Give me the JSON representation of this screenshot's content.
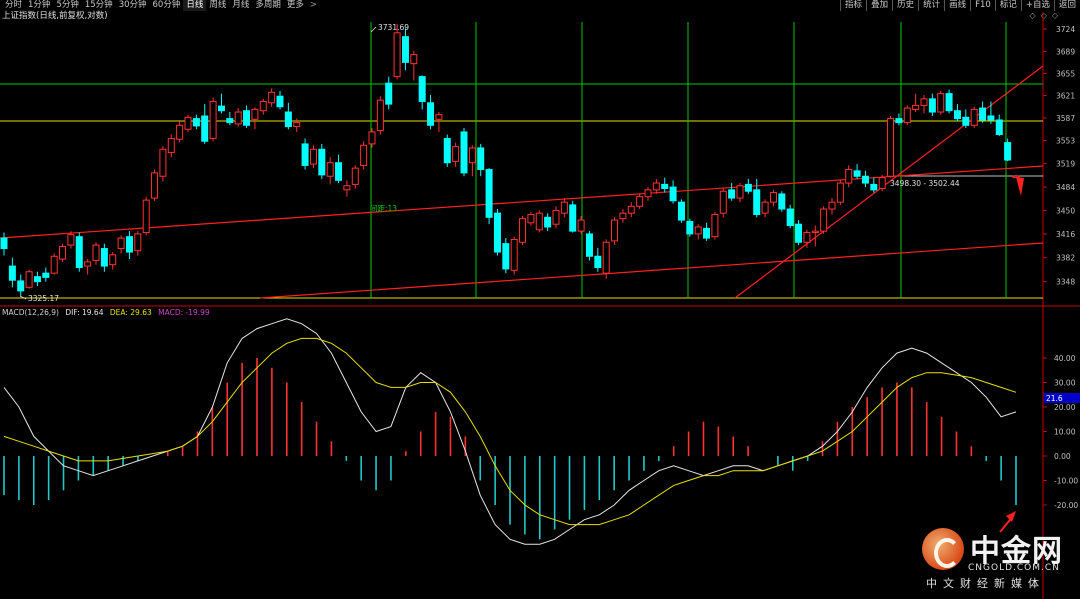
{
  "toolbar": {
    "tabs": [
      "分时",
      "1分钟",
      "5分钟",
      "15分钟",
      "30分钟",
      "60分钟",
      "日线",
      "周线",
      "月线",
      "多周期",
      "更多"
    ],
    "active_tab": "日线",
    "more_arrow": ">",
    "tools": [
      "指标",
      "叠加",
      "历史",
      "统计",
      "画线",
      "F10",
      "标记",
      "+自选",
      "返回"
    ]
  },
  "title": {
    "name": "上证指数(日线,前复权,对数)"
  },
  "window_controls": [
    "◇",
    "◇",
    "◇"
  ],
  "colors": {
    "up": "#ff3232",
    "down": "#00ffff",
    "ma_yellow": "#e8e000",
    "green": "#00c800",
    "axis": "#c80000",
    "text_red": "#ff5050"
  },
  "price_axis": {
    "labels": [
      "3724",
      "3689",
      "3655",
      "3621",
      "3587",
      "3553",
      "3519",
      "3484",
      "3450",
      "3416",
      "3382",
      "3348"
    ],
    "min": 3325,
    "max": 3735
  },
  "annotations": {
    "high_label": "3731.69",
    "low_label": "3325.17",
    "interval_label": "间距:13",
    "range_label": "3498.30 - 3502.44"
  },
  "macd": {
    "name": "MACD(12,26,9)",
    "dif_label": "DIF: 19.64",
    "dea_label": "DEA: 29.63",
    "macd_label": "MACD: -19.99",
    "axis_labels": [
      "40.00",
      "30.00",
      "20.00",
      "10.00",
      "0.00",
      "-10.00",
      "-20.00"
    ],
    "current_badge": "21.6"
  },
  "chart_data": {
    "type": "candlestick",
    "title": "上证指数(日线,前复权,对数)",
    "ylim": [
      3325,
      3735
    ],
    "candles": [
      [
        3410,
        3418,
        3385,
        3395
      ],
      [
        3370,
        3382,
        3340,
        3350
      ],
      [
        3349,
        3358,
        3328,
        3335
      ],
      [
        3340,
        3365,
        3338,
        3362
      ],
      [
        3355,
        3362,
        3342,
        3348
      ],
      [
        3360,
        3368,
        3348,
        3354
      ],
      [
        3360,
        3388,
        3358,
        3384
      ],
      [
        3380,
        3402,
        3376,
        3398
      ],
      [
        3400,
        3420,
        3395,
        3415
      ],
      [
        3412,
        3418,
        3362,
        3368
      ],
      [
        3370,
        3380,
        3358,
        3376
      ],
      [
        3378,
        3404,
        3372,
        3400
      ],
      [
        3395,
        3402,
        3362,
        3370
      ],
      [
        3372,
        3390,
        3365,
        3386
      ],
      [
        3395,
        3414,
        3388,
        3410
      ],
      [
        3412,
        3420,
        3380,
        3390
      ],
      [
        3392,
        3420,
        3385,
        3416
      ],
      [
        3418,
        3470,
        3414,
        3465
      ],
      [
        3468,
        3510,
        3464,
        3505
      ],
      [
        3500,
        3545,
        3492,
        3540
      ],
      [
        3535,
        3562,
        3528,
        3556
      ],
      [
        3555,
        3582,
        3550,
        3576
      ],
      [
        3570,
        3592,
        3566,
        3588
      ],
      [
        3586,
        3592,
        3570,
        3575
      ],
      [
        3590,
        3608,
        3548,
        3552
      ],
      [
        3556,
        3618,
        3552,
        3612
      ],
      [
        3605,
        3624,
        3594,
        3598
      ],
      [
        3586,
        3596,
        3576,
        3580
      ],
      [
        3578,
        3602,
        3574,
        3596
      ],
      [
        3598,
        3606,
        3572,
        3576
      ],
      [
        3585,
        3603,
        3570,
        3600
      ],
      [
        3598,
        3616,
        3592,
        3612
      ],
      [
        3610,
        3632,
        3604,
        3626
      ],
      [
        3620,
        3628,
        3600,
        3604
      ],
      [
        3596,
        3610,
        3570,
        3574
      ],
      [
        3574,
        3586,
        3566,
        3580
      ],
      [
        3548,
        3556,
        3510,
        3516
      ],
      [
        3518,
        3546,
        3512,
        3540
      ],
      [
        3540,
        3548,
        3496,
        3502
      ],
      [
        3500,
        3528,
        3488,
        3520
      ],
      [
        3520,
        3532,
        3490,
        3494
      ],
      [
        3480,
        3494,
        3470,
        3486
      ],
      [
        3488,
        3516,
        3482,
        3512
      ],
      [
        3516,
        3552,
        3510,
        3546
      ],
      [
        3548,
        3572,
        3542,
        3566
      ],
      [
        3568,
        3620,
        3562,
        3614
      ],
      [
        3640,
        3650,
        3600,
        3608
      ],
      [
        3650,
        3732,
        3646,
        3718
      ],
      [
        3712,
        3725,
        3660,
        3672
      ],
      [
        3670,
        3690,
        3644,
        3684
      ],
      [
        3650,
        3652,
        3600,
        3612
      ],
      [
        3610,
        3622,
        3570,
        3576
      ],
      [
        3585,
        3596,
        3566,
        3592
      ],
      [
        3556,
        3562,
        3514,
        3520
      ],
      [
        3522,
        3550,
        3514,
        3544
      ],
      [
        3566,
        3572,
        3500,
        3505
      ],
      [
        3520,
        3546,
        3500,
        3542
      ],
      [
        3542,
        3548,
        3500,
        3510
      ],
      [
        3510,
        3512,
        3430,
        3440
      ],
      [
        3446,
        3452,
        3385,
        3390
      ],
      [
        3402,
        3410,
        3360,
        3366
      ],
      [
        3364,
        3412,
        3358,
        3408
      ],
      [
        3404,
        3442,
        3400,
        3438
      ],
      [
        3432,
        3448,
        3428,
        3444
      ],
      [
        3422,
        3450,
        3418,
        3446
      ],
      [
        3440,
        3446,
        3420,
        3426
      ],
      [
        3430,
        3456,
        3424,
        3450
      ],
      [
        3446,
        3468,
        3440,
        3462
      ],
      [
        3458,
        3464,
        3418,
        3420
      ],
      [
        3420,
        3442,
        3416,
        3436
      ],
      [
        3416,
        3420,
        3378,
        3384
      ],
      [
        3384,
        3396,
        3362,
        3368
      ],
      [
        3360,
        3408,
        3352,
        3404
      ],
      [
        3406,
        3440,
        3400,
        3436
      ],
      [
        3438,
        3452,
        3432,
        3446
      ],
      [
        3446,
        3462,
        3440,
        3456
      ],
      [
        3456,
        3474,
        3452,
        3470
      ],
      [
        3470,
        3484,
        3464,
        3480
      ],
      [
        3480,
        3496,
        3474,
        3490
      ],
      [
        3488,
        3498,
        3476,
        3482
      ],
      [
        3484,
        3494,
        3460,
        3464
      ],
      [
        3462,
        3466,
        3432,
        3436
      ],
      [
        3434,
        3438,
        3412,
        3416
      ],
      [
        3416,
        3430,
        3408,
        3426
      ],
      [
        3424,
        3432,
        3406,
        3410
      ],
      [
        3412,
        3448,
        3408,
        3444
      ],
      [
        3446,
        3482,
        3440,
        3478
      ],
      [
        3480,
        3490,
        3464,
        3468
      ],
      [
        3468,
        3490,
        3462,
        3486
      ],
      [
        3488,
        3496,
        3474,
        3478
      ],
      [
        3480,
        3496,
        3440,
        3444
      ],
      [
        3446,
        3466,
        3440,
        3462
      ],
      [
        3462,
        3480,
        3456,
        3476
      ],
      [
        3474,
        3478,
        3448,
        3452
      ],
      [
        3452,
        3458,
        3424,
        3428
      ],
      [
        3430,
        3436,
        3400,
        3404
      ],
      [
        3404,
        3422,
        3396,
        3418
      ],
      [
        3418,
        3428,
        3398,
        3420
      ],
      [
        3420,
        3456,
        3416,
        3452
      ],
      [
        3452,
        3468,
        3444,
        3462
      ],
      [
        3462,
        3494,
        3458,
        3490
      ],
      [
        3490,
        3516,
        3484,
        3510
      ],
      [
        3508,
        3518,
        3496,
        3500
      ],
      [
        3500,
        3508,
        3484,
        3490
      ],
      [
        3488,
        3498,
        3476,
        3480
      ],
      [
        3482,
        3502,
        3478,
        3498
      ],
      [
        3500,
        3590,
        3498,
        3586
      ],
      [
        3586,
        3594,
        3576,
        3580
      ],
      [
        3580,
        3606,
        3576,
        3602
      ],
      [
        3600,
        3624,
        3596,
        3606
      ],
      [
        3606,
        3622,
        3594,
        3616
      ],
      [
        3616,
        3624,
        3590,
        3596
      ],
      [
        3596,
        3628,
        3592,
        3624
      ],
      [
        3624,
        3630,
        3594,
        3598
      ],
      [
        3598,
        3608,
        3582,
        3586
      ],
      [
        3588,
        3600,
        3572,
        3576
      ],
      [
        3576,
        3604,
        3572,
        3600
      ],
      [
        3602,
        3612,
        3580,
        3584
      ],
      [
        3590,
        3612,
        3578,
        3584
      ],
      [
        3584,
        3592,
        3560,
        3562
      ],
      [
        3550,
        3556,
        3522,
        3524
      ],
      [
        3498,
        3502,
        3498,
        3500
      ]
    ],
    "macd_dif": [
      28,
      20,
      8,
      2,
      -4,
      -6,
      -8,
      -6,
      -4,
      -2,
      0,
      2,
      4,
      8,
      20,
      38,
      48,
      52,
      54,
      56,
      54,
      50,
      42,
      30,
      18,
      10,
      12,
      28,
      34,
      30,
      18,
      2,
      -16,
      -28,
      -34,
      -36,
      -36,
      -34,
      -30,
      -26,
      -24,
      -20,
      -14,
      -10,
      -6,
      -4,
      -6,
      -8,
      -6,
      -4,
      -4,
      -6,
      -4,
      -2,
      0,
      4,
      10,
      18,
      28,
      36,
      42,
      44,
      42,
      38,
      34,
      30,
      24,
      16,
      18
    ],
    "macd_dea": [
      8,
      6,
      4,
      2,
      0,
      -2,
      -2,
      -2,
      -1,
      0,
      1,
      2,
      4,
      8,
      14,
      22,
      30,
      36,
      42,
      46,
      48,
      48,
      46,
      42,
      36,
      30,
      28,
      28,
      30,
      30,
      26,
      18,
      8,
      -4,
      -14,
      -20,
      -24,
      -26,
      -28,
      -28,
      -28,
      -26,
      -24,
      -20,
      -16,
      -12,
      -10,
      -8,
      -8,
      -6,
      -6,
      -6,
      -4,
      -2,
      0,
      2,
      6,
      10,
      16,
      22,
      28,
      32,
      34,
      34,
      33,
      32,
      30,
      28,
      26
    ],
    "macd_hist": [
      -16,
      -18,
      -20,
      -18,
      -14,
      -10,
      -8,
      -6,
      -4,
      -2,
      0,
      2,
      4,
      10,
      20,
      30,
      38,
      40,
      36,
      30,
      22,
      14,
      6,
      -2,
      -10,
      -14,
      -10,
      2,
      10,
      18,
      16,
      8,
      -10,
      -20,
      -28,
      -32,
      -34,
      -30,
      -26,
      -22,
      -18,
      -14,
      -10,
      -6,
      -2,
      4,
      10,
      14,
      12,
      8,
      4,
      0,
      -4,
      -6,
      -2,
      6,
      14,
      20,
      24,
      28,
      30,
      28,
      22,
      16,
      10,
      4,
      -2,
      -10,
      -20
    ]
  }
}
